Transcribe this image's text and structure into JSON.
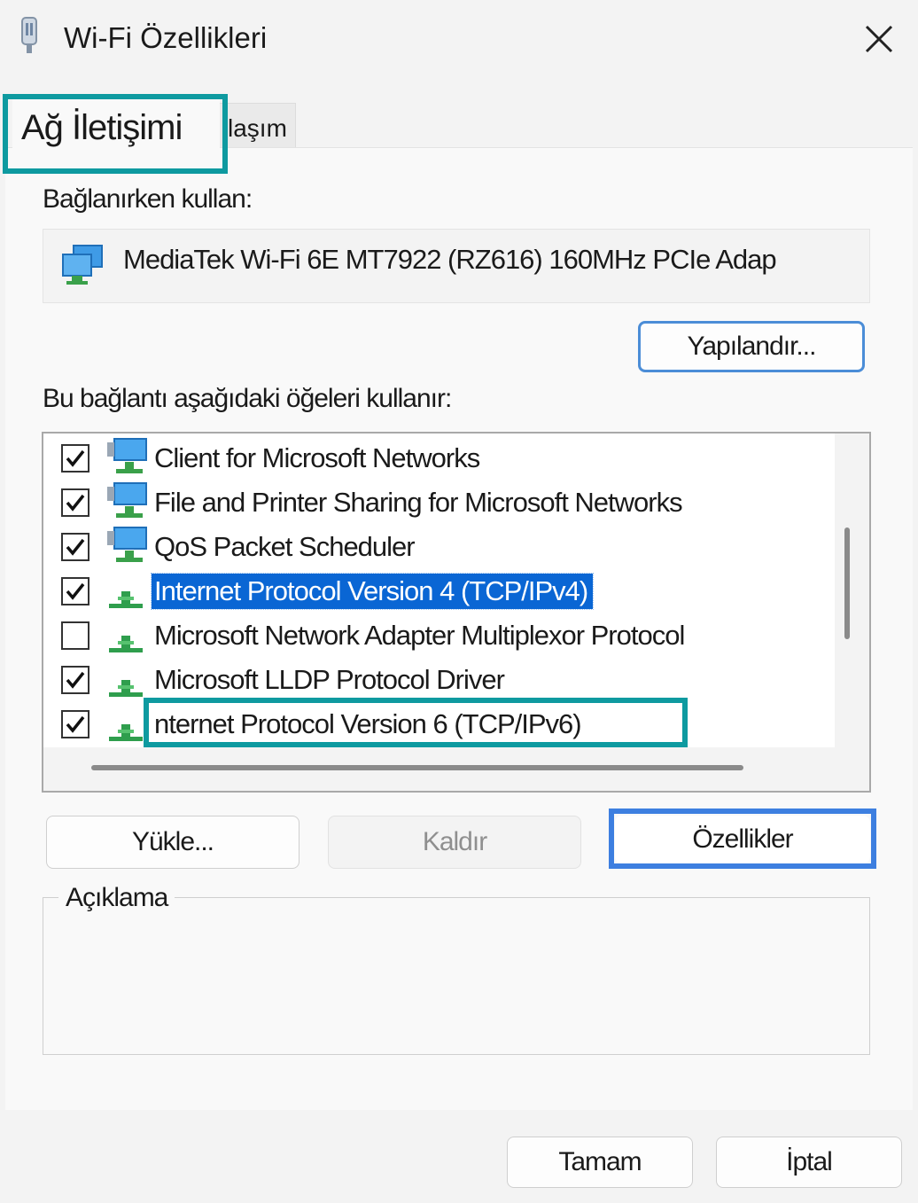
{
  "window": {
    "title": "Wi-Fi Özellikleri",
    "title_icon": "wifi-adapter-icon",
    "close_icon": "close-icon"
  },
  "tabs": [
    {
      "label": "Ağ İletişimi",
      "active": true
    },
    {
      "label": "laşım",
      "active": false
    }
  ],
  "connect_using": {
    "label": "Bağlanırken kullan:",
    "adapter": "MediaTek Wi-Fi 6E MT7922 (RZ616) 160MHz PCIe Adap",
    "configure_button": "Yapılandır..."
  },
  "items": {
    "label": "Bu bağlantı aşağıdaki öğeleri kullanır:",
    "list": [
      {
        "label": "Client for Microsoft Networks",
        "checked": true,
        "icon": "network-client-icon",
        "selected": false
      },
      {
        "label": "File and Printer Sharing for Microsoft Networks",
        "checked": true,
        "icon": "network-service-icon",
        "selected": false
      },
      {
        "label": "QoS Packet Scheduler",
        "checked": true,
        "icon": "network-service-icon",
        "selected": false
      },
      {
        "label": "Internet Protocol Version 4 (TCP/IPv4)",
        "checked": true,
        "icon": "protocol-icon",
        "selected": true
      },
      {
        "label": "Microsoft Network Adapter Multiplexor Protocol",
        "checked": false,
        "icon": "protocol-icon",
        "selected": false
      },
      {
        "label": "Microsoft LLDP Protocol Driver",
        "checked": true,
        "icon": "protocol-icon",
        "selected": false
      },
      {
        "label": "nternet Protocol Version 6 (TCP/IPv6)",
        "checked": true,
        "icon": "protocol-icon",
        "selected": false
      }
    ]
  },
  "buttons": {
    "install": "Yükle...",
    "uninstall": "Kaldır",
    "properties": "Özellikler",
    "ok": "Tamam",
    "cancel": "İptal"
  },
  "description": {
    "label": "Açıklama",
    "text": ""
  },
  "colors": {
    "highlight_teal": "#0e9aa0",
    "highlight_blue": "#3d7fe0",
    "selection": "#0a66d4"
  }
}
